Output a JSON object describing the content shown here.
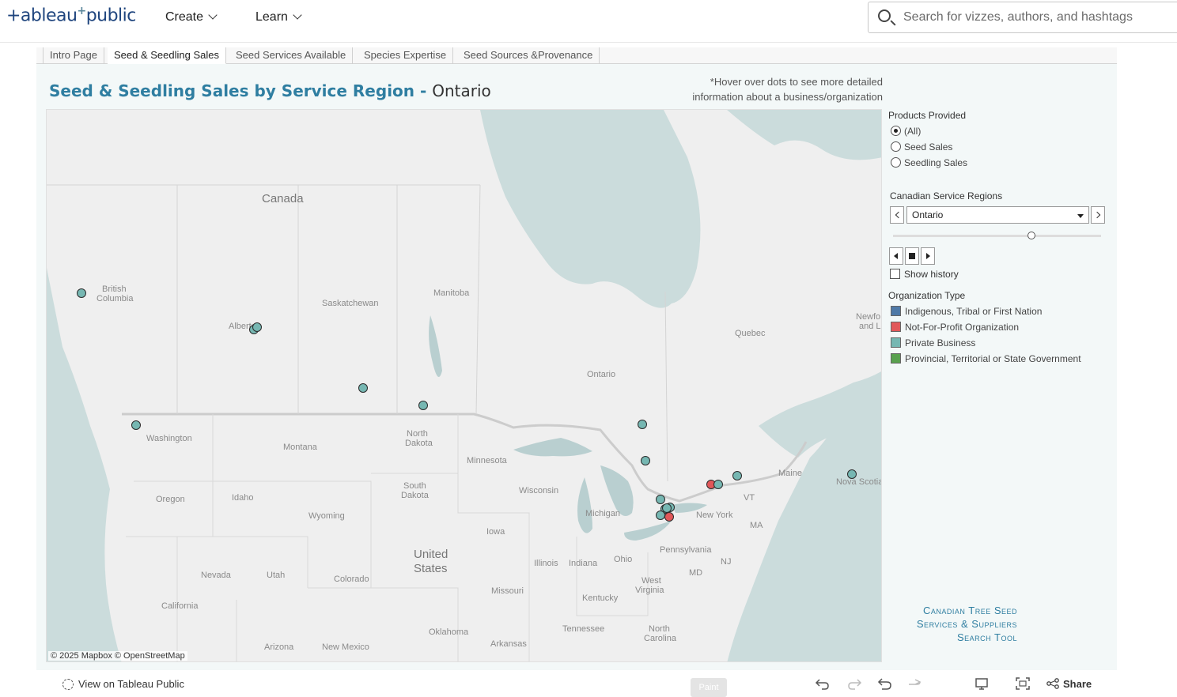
{
  "nav": {
    "logo_left": "+ableau",
    "logo_right": "public",
    "items": [
      {
        "label": "Create"
      },
      {
        "label": "Learn"
      }
    ],
    "search_placeholder": "Search for vizzes, authors, and hashtags"
  },
  "tabs": [
    {
      "label": "Intro Page"
    },
    {
      "label": "Seed & Seedling Sales",
      "active": true
    },
    {
      "label": "Seed Services Available"
    },
    {
      "label": "Species Expertise"
    },
    {
      "label": "Seed Sources &Provenance"
    }
  ],
  "title": {
    "main": "Seed & Seedling Sales by Service Region - ",
    "region": "Ontario"
  },
  "hover_note": {
    "line1": "*Hover over dots to see more detailed",
    "line2": "information about a business/organization"
  },
  "map": {
    "credit": "© 2025 Mapbox  © OpenStreetMap",
    "labels": {
      "canada": "Canada",
      "us1": "United",
      "us2": "States",
      "bc1": "British",
      "bc2": "Columbia",
      "alberta": "Alberta",
      "saskatchewan": "Saskatchewan",
      "manitoba": "Manitoba",
      "ontario": "Ontario",
      "quebec": "Quebec",
      "newf1": "Newfo",
      "newf2": "and La",
      "washington": "Washington",
      "montana": "Montana",
      "north_dakota1": "North",
      "north_dakota2": "Dakota",
      "minnesota": "Minnesota",
      "south_dakota1": "South",
      "south_dakota2": "Dakota",
      "oregon": "Oregon",
      "idaho": "Idaho",
      "wyoming": "Wyoming",
      "wisconsin": "Wisconsin",
      "michigan": "Michigan",
      "iowa": "Iowa",
      "nevada": "Nevada",
      "utah": "Utah",
      "colorado": "Colorado",
      "illinois": "Illinois",
      "indiana": "Indiana",
      "ohio": "Ohio",
      "pennsylvania": "Pennsylvania",
      "new_york": "New York",
      "maine": "Maine",
      "nova_scotia": "Nova Scotia",
      "vt": "VT",
      "ma": "MA",
      "nj": "NJ",
      "md": "MD",
      "california": "California",
      "missouri": "Missouri",
      "kentucky": "Kentucky",
      "west_virginia1": "West",
      "west_virginia2": "Virginia",
      "tennessee": "Tennessee",
      "north_carolina1": "North",
      "north_carolina2": "Carolina",
      "arizona": "Arizona",
      "new_mexico": "New Mexico",
      "oklahoma": "Oklahoma",
      "arkansas": "Arkansas"
    },
    "dots": [
      {
        "type": "Private Business",
        "color": "#76b7b2"
      },
      {
        "type": "Private Business",
        "color": "#76b7b2"
      },
      {
        "type": "Private Business",
        "color": "#76b7b2"
      },
      {
        "type": "Private Business",
        "color": "#76b7b2"
      },
      {
        "type": "Private Business",
        "color": "#76b7b2"
      },
      {
        "type": "Private Business",
        "color": "#76b7b2"
      },
      {
        "type": "Private Business",
        "color": "#76b7b2"
      },
      {
        "type": "Private Business",
        "color": "#76b7b2"
      },
      {
        "type": "Private Business",
        "color": "#76b7b2"
      },
      {
        "type": "Private Business",
        "color": "#76b7b2"
      },
      {
        "type": "Not-For-Profit Organization",
        "color": "#e15759"
      },
      {
        "type": "Private Business",
        "color": "#76b7b2"
      },
      {
        "type": "Private Business",
        "color": "#76b7b2"
      },
      {
        "type": "Private Business",
        "color": "#76b7b2"
      },
      {
        "type": "Private Business",
        "color": "#76b7b2"
      },
      {
        "type": "Private Business",
        "color": "#76b7b2"
      },
      {
        "type": "Private Business",
        "color": "#76b7b2"
      },
      {
        "type": "Not-For-Profit Organization",
        "color": "#e15759"
      }
    ]
  },
  "filters": {
    "products_title": "Products Provided",
    "products": [
      {
        "label": "(All)",
        "selected": true
      },
      {
        "label": "Seed Sales",
        "selected": false
      },
      {
        "label": "Seedling Sales",
        "selected": false
      }
    ],
    "regions_title": "Canadian Service Regions",
    "region_value": "Ontario",
    "show_history": "Show history"
  },
  "legend": {
    "title": "Organization Type",
    "items": [
      {
        "label": "Indigenous, Tribal or First Nation",
        "color": "#4e79a7"
      },
      {
        "label": "Not-For-Profit Organization",
        "color": "#e15759"
      },
      {
        "label": "Private Business",
        "color": "#76b7b2"
      },
      {
        "label": "Provincial, Territorial or State Government",
        "color": "#59a14f"
      }
    ]
  },
  "brand": {
    "line1": "Canadian Tree Seed",
    "line2": "Services & Suppliers",
    "line3": "Search Tool"
  },
  "toolbar": {
    "view_label": "View on Tableau Public",
    "paint_label": "Paint",
    "share_label": "Share"
  }
}
